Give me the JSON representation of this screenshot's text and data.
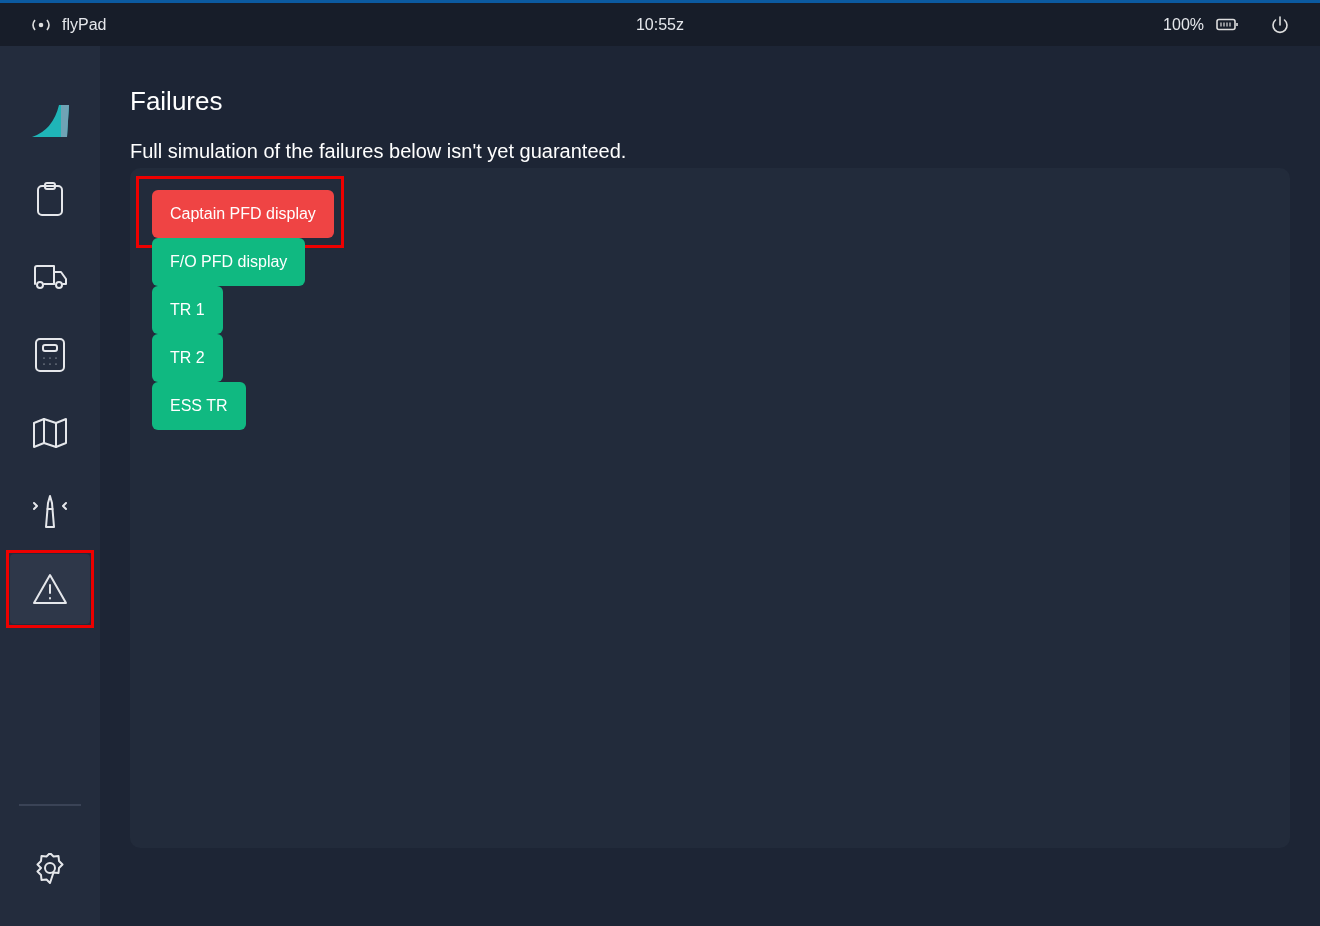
{
  "status_bar": {
    "app_name": "flyPad",
    "time": "10:55z",
    "battery": "100%"
  },
  "sidebar": {
    "items": [
      {
        "kind": "logo",
        "selected": false,
        "highlighted": false
      },
      {
        "kind": "clipboard",
        "selected": false,
        "highlighted": false
      },
      {
        "kind": "truck",
        "selected": false,
        "highlighted": false
      },
      {
        "kind": "calculator",
        "selected": false,
        "highlighted": false
      },
      {
        "kind": "map",
        "selected": false,
        "highlighted": false
      },
      {
        "kind": "tower",
        "selected": false,
        "highlighted": false
      },
      {
        "kind": "warning",
        "selected": true,
        "highlighted": true
      }
    ],
    "bottom_items": [
      {
        "kind": "settings",
        "selected": false,
        "highlighted": false
      }
    ]
  },
  "page": {
    "title": "Failures",
    "notice": "Full simulation of the failures below isn't yet guaranteed.",
    "failures": [
      {
        "label": "Captain PFD display",
        "failed": true,
        "highlighted": true
      },
      {
        "label": "F/O PFD display",
        "failed": false,
        "highlighted": false
      },
      {
        "label": "TR 1",
        "failed": false,
        "highlighted": false
      },
      {
        "label": "TR 2",
        "failed": false,
        "highlighted": false
      },
      {
        "label": "ESS TR",
        "failed": false,
        "highlighted": false
      }
    ]
  }
}
